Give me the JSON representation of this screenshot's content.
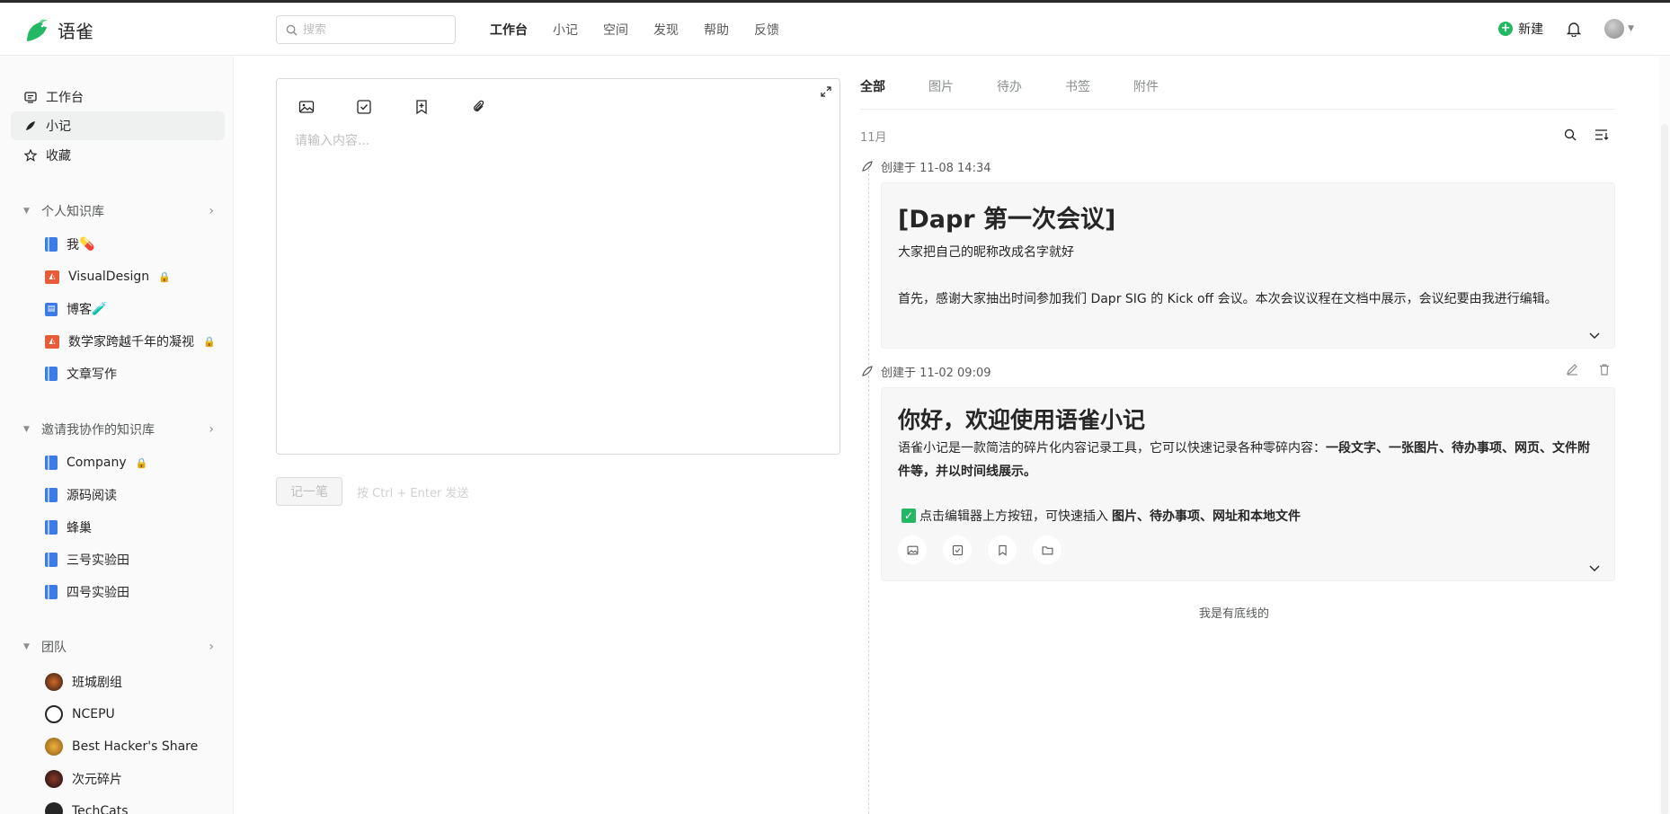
{
  "app": {
    "name": "语雀",
    "brand_color": "#25b864"
  },
  "search": {
    "placeholder": "搜索"
  },
  "nav": {
    "items": [
      "工作台",
      "小记",
      "空间",
      "发现",
      "帮助",
      "反馈"
    ],
    "active": "工作台"
  },
  "header_right": {
    "new_label": "新建"
  },
  "sidebar": {
    "top_items": [
      {
        "label": "工作台",
        "icon": "workbench-icon"
      },
      {
        "label": "小记",
        "icon": "pen-icon",
        "active": true
      },
      {
        "label": "收藏",
        "icon": "star-icon"
      }
    ],
    "personal": {
      "title": "个人知识库",
      "books": [
        {
          "label": "我",
          "emoji": "💊",
          "type": "book"
        },
        {
          "label": "VisualDesign",
          "type": "board",
          "locked": true
        },
        {
          "label": "博客",
          "emoji": "🧪",
          "type": "blog"
        },
        {
          "label": "数学家跨越千年的凝视",
          "type": "board",
          "locked": true
        },
        {
          "label": "文章写作",
          "type": "book"
        }
      ]
    },
    "invited": {
      "title": "邀请我协作的知识库",
      "books": [
        {
          "label": "Company",
          "locked": true
        },
        {
          "label": "源码阅读"
        },
        {
          "label": "蜂巢"
        },
        {
          "label": "三号实验田"
        },
        {
          "label": "四号实验田"
        }
      ]
    },
    "teams": {
      "title": "团队",
      "items": [
        "班城剧组",
        "NCEPU",
        "Best Hacker's Share",
        "次元碎片",
        "TechCats"
      ]
    }
  },
  "editor": {
    "placeholder": "请输入内容...",
    "send_label": "记一笔",
    "send_hint": "按 Ctrl + Enter 发送"
  },
  "feed": {
    "tabs": [
      "全部",
      "图片",
      "待办",
      "书签",
      "附件"
    ],
    "active_tab": "全部",
    "month": "11月",
    "notes": [
      {
        "meta": "创建于 11-08 14:34",
        "title": "[Dapr 第一次会议]",
        "lines": [
          "大家把自己的昵称改成名字就好",
          "首先，感谢大家抽出时间参加我们 Dapr SIG 的 Kick off 会议。本次会议议程在文档中展示，会议纪要由我进行编辑。"
        ]
      },
      {
        "meta": "创建于 11-02 09:09",
        "title": "你好，欢迎使用语雀小记",
        "intro_plain": "语雀小记是一款简洁的碎片化内容记录工具，它可以快速记录各种零碎内容：",
        "intro_bold_1": "一段文字、一张图片、待办事项、网页、文件附件等，并以时间线展示。",
        "todo_plain": "点击编辑器上方按钮，可快速插入",
        "todo_bold": "图片、待办事项、网址和本地文件"
      }
    ],
    "bottom_note": "我是有底线的"
  }
}
